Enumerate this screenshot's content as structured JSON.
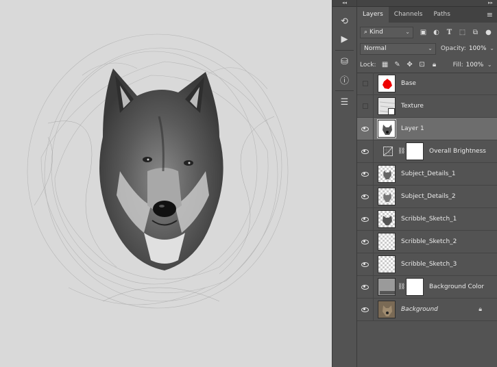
{
  "panel": {
    "tabs": [
      {
        "label": "Layers",
        "active": true
      },
      {
        "label": "Channels",
        "active": false
      },
      {
        "label": "Paths",
        "active": false
      }
    ],
    "filter": {
      "kind_label": "Kind"
    },
    "blend_mode": "Normal",
    "opacity_label": "Opacity:",
    "opacity_value": "100%",
    "lock_label": "Lock:",
    "fill_label": "Fill:",
    "fill_value": "100%"
  },
  "layers": [
    {
      "name": "Base",
      "visible": false,
      "thumb": "red-splash"
    },
    {
      "name": "Texture",
      "visible": false,
      "thumb": "texture-smart"
    },
    {
      "name": "Layer 1",
      "visible": true,
      "thumb": "wolf-sketch",
      "selected": true
    },
    {
      "name": "Overall Brightness",
      "visible": true,
      "thumb": "adjustment-curves",
      "mask": true
    },
    {
      "name": "Subject_Details_1",
      "visible": true,
      "thumb": "wolf-small"
    },
    {
      "name": "Subject_Details_2",
      "visible": true,
      "thumb": "wolf-small"
    },
    {
      "name": "Scribble_Sketch_1",
      "visible": true,
      "thumb": "wolf-small"
    },
    {
      "name": "Scribble_Sketch_2",
      "visible": true,
      "thumb": "transparent"
    },
    {
      "name": "Scribble_Sketch_3",
      "visible": true,
      "thumb": "transparent"
    },
    {
      "name": "Background Color",
      "visible": true,
      "thumb": "gray-fill",
      "mask": true
    },
    {
      "name": "Background",
      "visible": true,
      "thumb": "wolf-photo",
      "locked": true,
      "italic": true
    }
  ],
  "colors": {
    "panel_bg": "#535353",
    "selected_row": "#6d6d6d",
    "canvas_bg": "#d9d9d9"
  }
}
